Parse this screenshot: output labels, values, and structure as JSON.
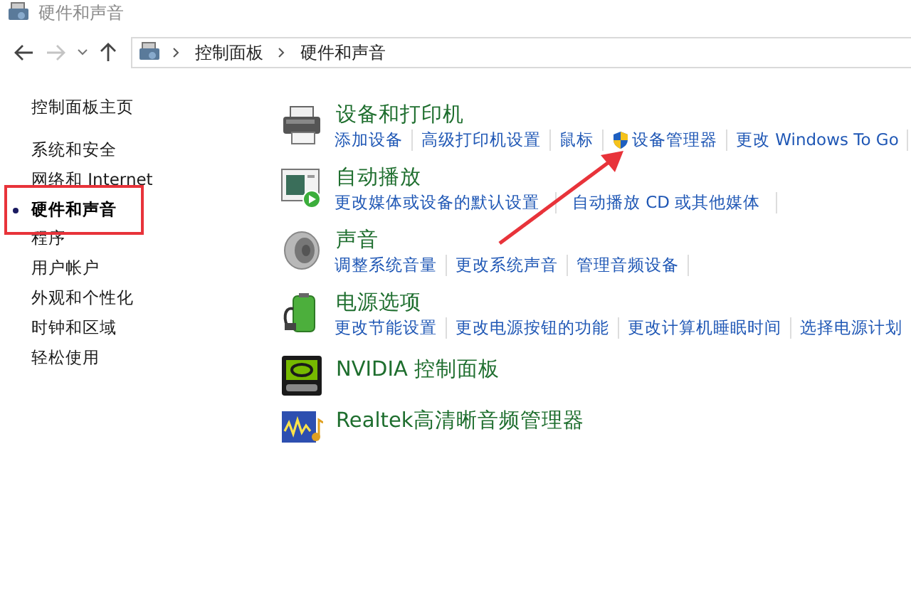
{
  "window": {
    "title": "硬件和声音"
  },
  "navigation": {
    "back_enabled": true,
    "forward_enabled": false,
    "breadcrumbs": [
      "控制面板",
      "硬件和声音"
    ]
  },
  "sidebar": {
    "home": "控制面板主页",
    "items": [
      {
        "label": "系统和安全",
        "selected": false
      },
      {
        "label": "网络和 Internet",
        "selected": false
      },
      {
        "label": "硬件和声音",
        "selected": true
      },
      {
        "label": "程序",
        "selected": false
      },
      {
        "label": "用户帐户",
        "selected": false
      },
      {
        "label": "外观和个性化",
        "selected": false
      },
      {
        "label": "时钟和区域",
        "selected": false
      },
      {
        "label": "轻松使用",
        "selected": false
      }
    ]
  },
  "categories": [
    {
      "title": "设备和打印机",
      "links": [
        {
          "label": "添加设备",
          "shield": false
        },
        {
          "label": "高级打印机设置",
          "shield": false
        },
        {
          "label": "鼠标",
          "shield": false
        },
        {
          "label": "设备管理器",
          "shield": true
        },
        {
          "label": "更改 Windows To Go",
          "shield": false
        }
      ]
    },
    {
      "title": "自动播放",
      "links": [
        {
          "label": "更改媒体或设备的默认设置",
          "shield": false
        },
        {
          "label": "自动播放 CD 或其他媒体",
          "shield": false
        }
      ]
    },
    {
      "title": "声音",
      "links": [
        {
          "label": "调整系统音量",
          "shield": false
        },
        {
          "label": "更改系统声音",
          "shield": false
        },
        {
          "label": "管理音频设备",
          "shield": false
        }
      ]
    },
    {
      "title": "电源选项",
      "links": [
        {
          "label": "更改节能设置",
          "shield": false
        },
        {
          "label": "更改电源按钮的功能",
          "shield": false
        },
        {
          "label": "更改计算机睡眠时间",
          "shield": false
        },
        {
          "label": "选择电源计划",
          "shield": false
        }
      ]
    },
    {
      "title": "NVIDIA 控制面板"
    },
    {
      "title": "Realtek高清晰音频管理器"
    }
  ],
  "annotations": {
    "highlight_box": true,
    "arrow": true
  }
}
